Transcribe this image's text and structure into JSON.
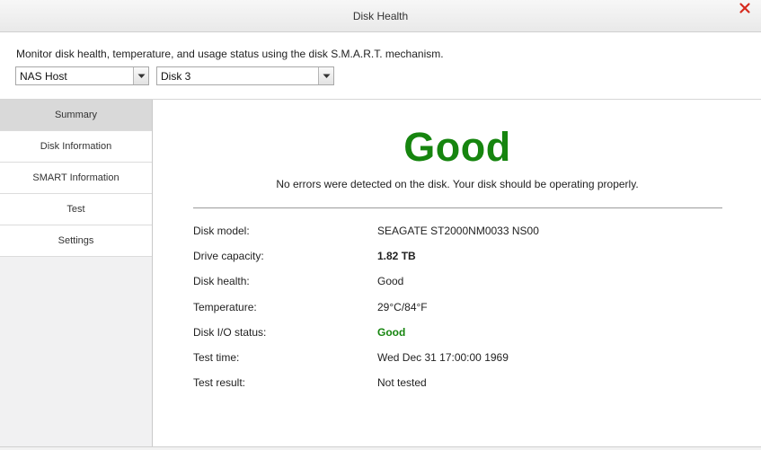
{
  "window": {
    "title": "Disk Health"
  },
  "header": {
    "description": "Monitor disk health, temperature, and usage status using the disk S.M.A.R.T. mechanism.",
    "host_select": {
      "value": "NAS Host"
    },
    "disk_select": {
      "value": "Disk 3"
    }
  },
  "sidebar": {
    "items": [
      {
        "label": "Summary",
        "active": true
      },
      {
        "label": "Disk Information"
      },
      {
        "label": "SMART Information"
      },
      {
        "label": "Test"
      },
      {
        "label": "Settings"
      }
    ]
  },
  "summary": {
    "status": "Good",
    "message": "No errors were detected on the disk. Your disk should be operating properly.",
    "rows": [
      {
        "label": "Disk model:",
        "value": "SEAGATE ST2000NM0033 NS00"
      },
      {
        "label": "Drive capacity:",
        "value": "1.82 TB"
      },
      {
        "label": "Disk health:",
        "value": "Good"
      },
      {
        "label": "Temperature:",
        "value": "29°C/84°F"
      },
      {
        "label": "Disk I/O status:",
        "value": "Good"
      },
      {
        "label": "Test time:",
        "value": "Wed Dec 31 17:00:00 1969"
      },
      {
        "label": "Test result:",
        "value": "Not tested"
      }
    ]
  },
  "colors": {
    "good": "#16850f",
    "close": "#d62a1e",
    "active_tab": "#d9d9d9"
  },
  "icons": {
    "close": "close-icon",
    "dropdown": "chevron-down-icon"
  }
}
